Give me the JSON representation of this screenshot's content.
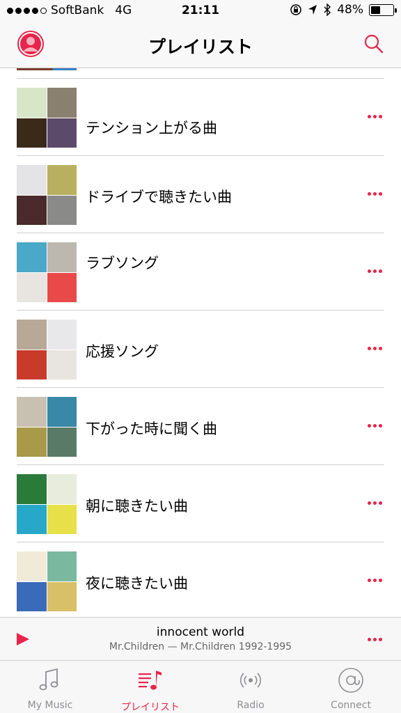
{
  "status_bar": {
    "carrier": "SoftBank",
    "network": "4G",
    "time": "21:11",
    "battery": "48%",
    "battery_level": 0.48
  },
  "nav": {
    "title": "プレイリスト",
    "profile_icon": "profile-icon",
    "search_icon": "search-icon"
  },
  "playlists": [
    {
      "title": "テンション上がる曲",
      "art_colors": [
        "#d7e6c8",
        "#8a8070",
        "#3a2a1a",
        "#5c4a6a"
      ]
    },
    {
      "title": "ドライブで聴きたい曲",
      "art_colors": [
        "#e4e4e6",
        "#b8b060",
        "#4a2a2a",
        "#8a8a88"
      ]
    },
    {
      "title": "ラブソング",
      "art_colors": [
        "#4aa8c8",
        "#bcb8b0",
        "#e8e4e0",
        "#e84a4a"
      ]
    },
    {
      "title": "応援ソング",
      "art_colors": [
        "#b8a898",
        "#e8e8ea",
        "#c83a2a",
        "#e8e4e0"
      ]
    },
    {
      "title": "下がった時に聞く曲",
      "art_colors": [
        "#c8c0b0",
        "#3a88a8",
        "#a89a48",
        "#5a7a68"
      ]
    },
    {
      "title": "朝に聴きたい曲",
      "art_colors": [
        "#2a7a3a",
        "#e8ecdc",
        "#28a8c8",
        "#e8e048"
      ]
    },
    {
      "title": "夜に聴きたい曲",
      "art_colors": [
        "#f0ead8",
        "#7ab8a0",
        "#3a6ab8",
        "#d8c068"
      ]
    }
  ],
  "now_playing": {
    "title": "innocent world",
    "subtitle": "Mr.Children — Mr.Children 1992-1995"
  },
  "tabs": [
    {
      "label": "My Music",
      "icon": "music-note-icon"
    },
    {
      "label": "プレイリスト",
      "icon": "playlist-icon"
    },
    {
      "label": "Radio",
      "icon": "radio-icon"
    },
    {
      "label": "Connect",
      "icon": "connect-icon"
    }
  ],
  "colors": {
    "accent": "#e8244a",
    "tab_inactive": "#8e8e93"
  }
}
